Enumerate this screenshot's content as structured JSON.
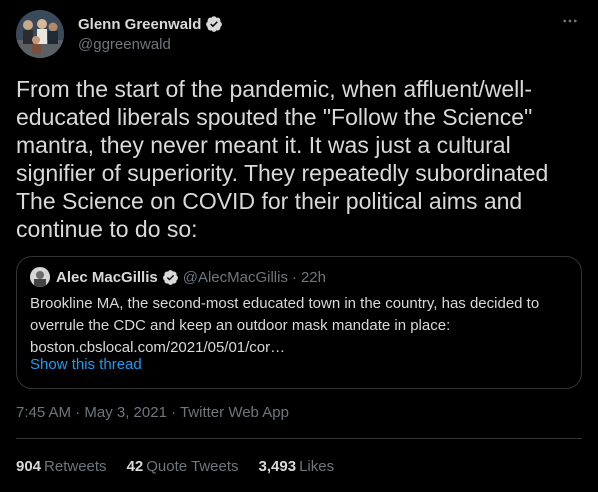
{
  "author": {
    "name": "Glenn Greenwald",
    "handle": "@ggreenwald",
    "verified": true
  },
  "more_icon": "more-horizontal-icon",
  "tweet": {
    "text": "From the start of the pandemic, when affluent/well-educated liberals spouted the \"Follow the Science\" mantra, they never meant it. It was just a cultural signifier of superiority. They repeatedly subordinated The Science on COVID for their political aims and continue to do so:"
  },
  "quoted": {
    "name": "Alec MacGillis",
    "handle": "@AlecMacGillis",
    "separator": "·",
    "time": "22h",
    "text": "Brookline MA, the second-most educated town in the country, has decided to overrule the CDC and keep an outdoor mask mandate in place: boston.cbslocal.com/2021/05/01/cor…",
    "show_thread": "Show this thread"
  },
  "meta": {
    "timestamp": "7:45 AM · May 3, 2021 · Twitter Web App"
  },
  "stats": {
    "retweets": "904",
    "retweets_label": "Retweets",
    "quotes": "42",
    "quotes_label": "Quote Tweets",
    "likes": "3,493",
    "likes_label": "Likes"
  },
  "colors": {
    "background": "#000000",
    "text": "#d9d9d9",
    "secondary": "#6e767d",
    "link": "#1d9bf0",
    "border": "#2f3336"
  }
}
